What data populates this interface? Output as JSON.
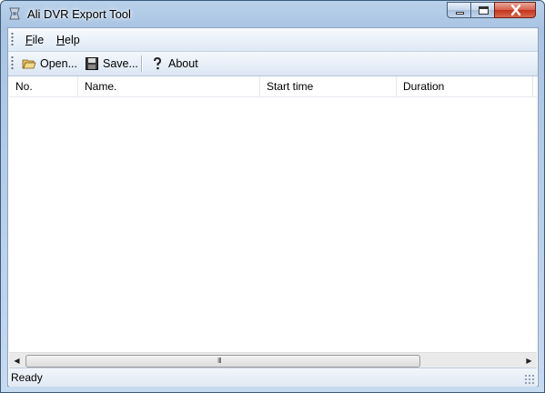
{
  "window": {
    "title": "Ali DVR Export Tool"
  },
  "menu": [
    {
      "label": "File",
      "mnemonic": "F",
      "rest": "ile"
    },
    {
      "label": "Help",
      "mnemonic": "H",
      "rest": "elp"
    }
  ],
  "toolbar": {
    "open_label": "Open...",
    "save_label": "Save...",
    "about_label": "About"
  },
  "list": {
    "columns": [
      "No.",
      "Name.",
      "Start time",
      "Duration"
    ],
    "rows": []
  },
  "scrollbar": {
    "thumb_glyph": "III"
  },
  "status": {
    "text": "Ready"
  },
  "colors": {
    "close_button": "#c4321c",
    "frame": "#b9d1ea"
  }
}
